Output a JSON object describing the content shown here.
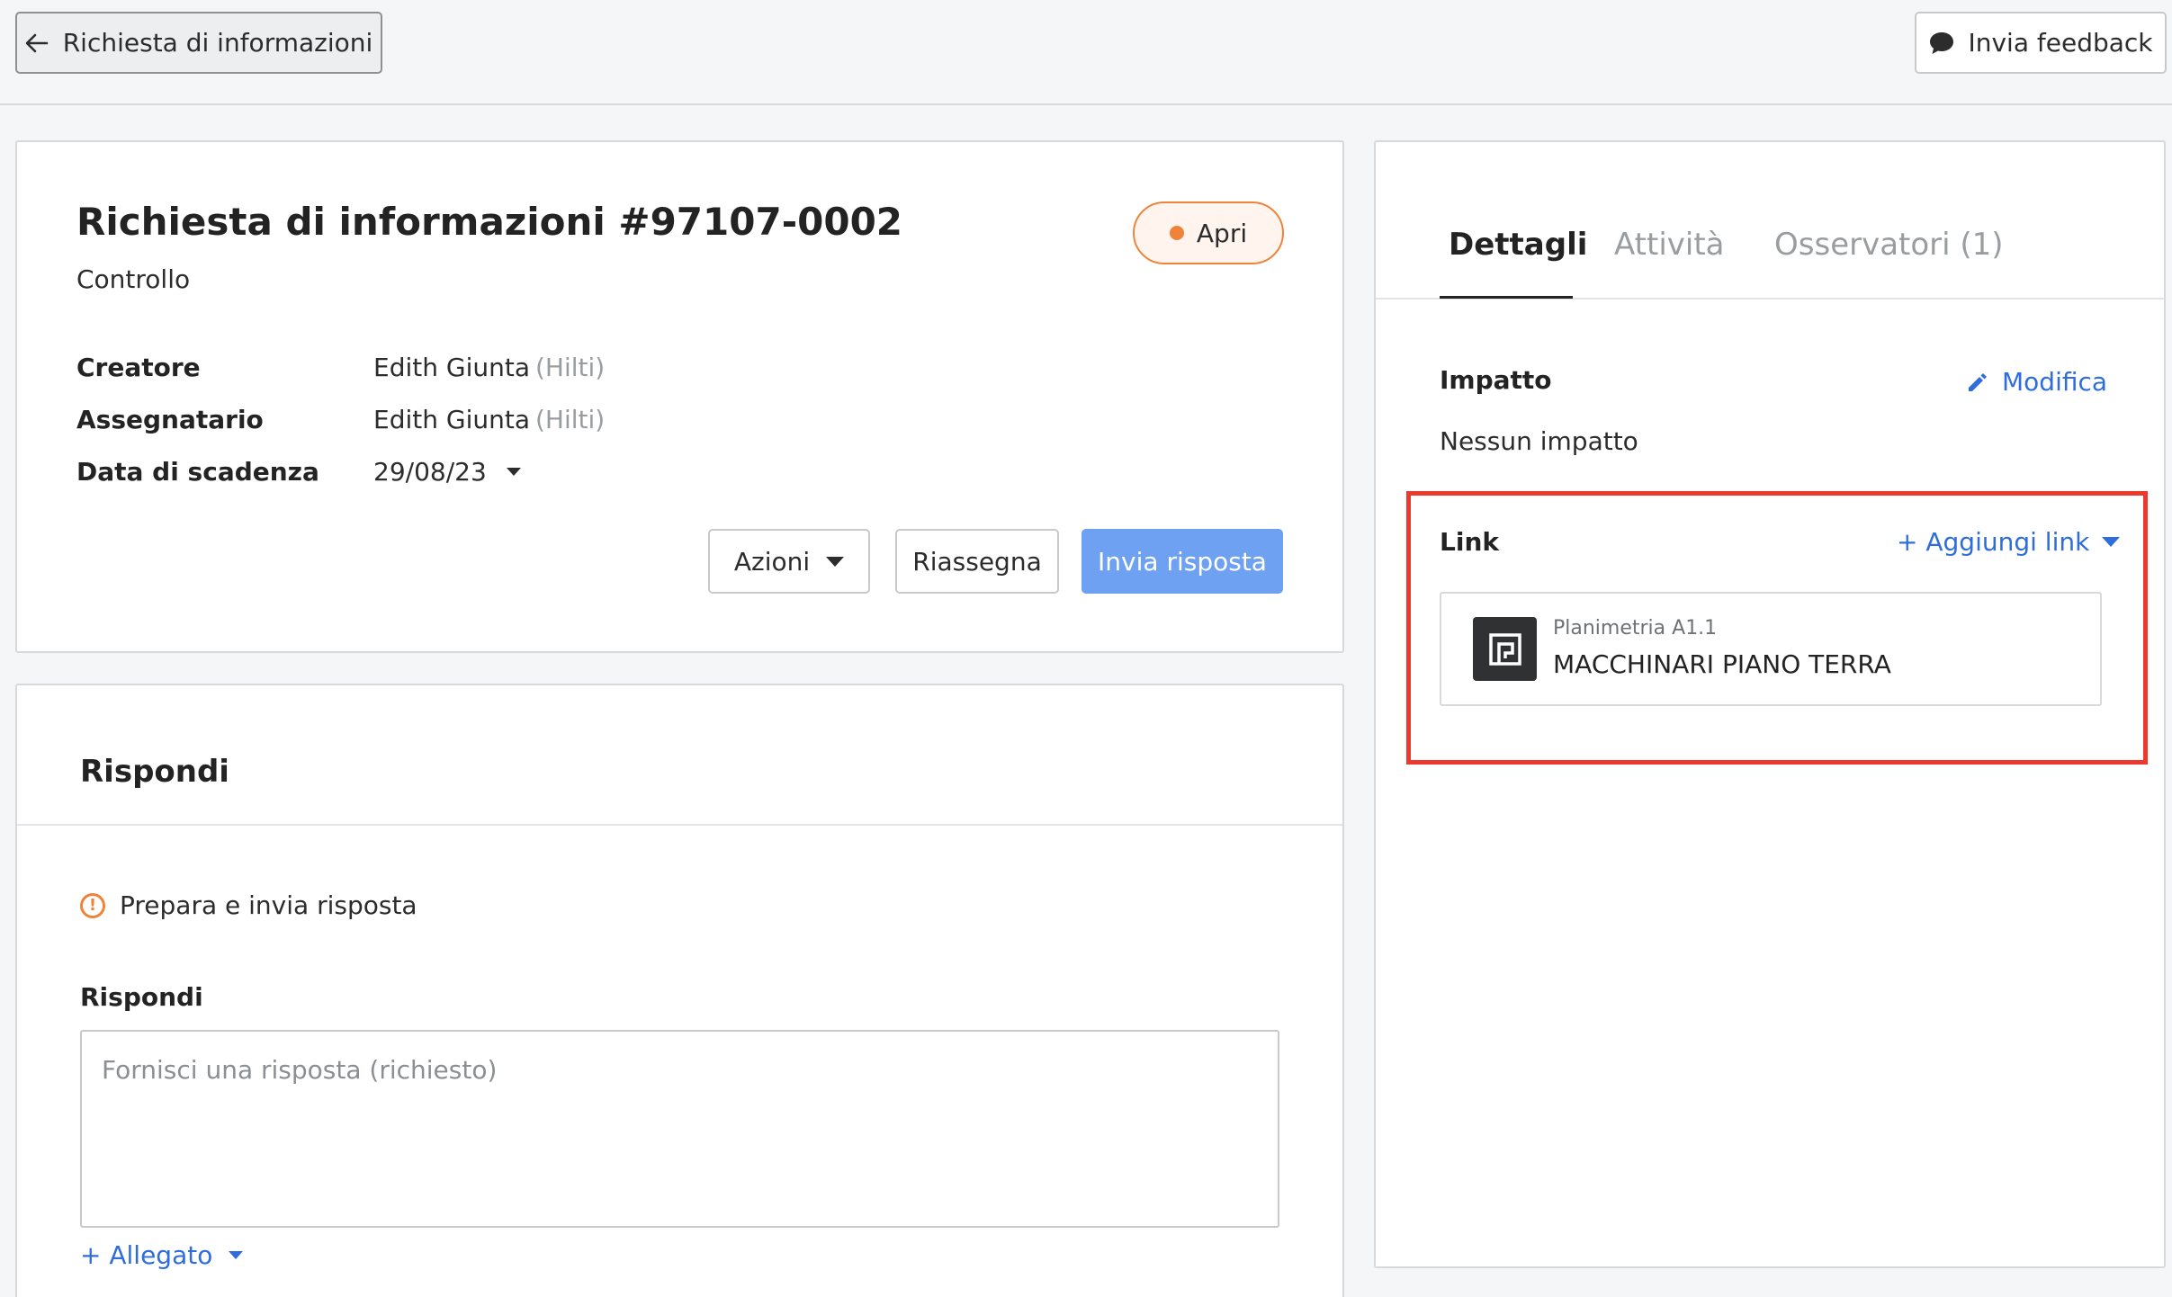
{
  "topbar": {
    "back_label": "Richiesta di informazioni",
    "feedback_label": "Invia feedback"
  },
  "main": {
    "title": "Richiesta di informazioni #97107-0002",
    "subtitle": "Controllo",
    "status": "Apri",
    "fields": [
      {
        "label": "Creatore",
        "name": "Edith Giunta",
        "org": "(Hilti)"
      },
      {
        "label": "Assegnatario",
        "name": "Edith Giunta",
        "org": "(Hilti)"
      },
      {
        "label": "Data di scadenza",
        "value": "29/08/23"
      }
    ],
    "actions_label": "Azioni",
    "reassign_label": "Riassegna",
    "send_label": "Invia risposta"
  },
  "reply": {
    "title": "Rispondi",
    "warning": "Prepara e invia risposta",
    "label": "Rispondi",
    "placeholder": "Fornisci una risposta (richiesto)",
    "attach_label": "+ Allegato"
  },
  "side": {
    "tabs": [
      "Dettagli",
      "Attività",
      "Osservatori (1)"
    ],
    "impact_label": "Impatto",
    "edit_label": "Modifica",
    "impact_value": "Nessun impatto",
    "link_label": "Link",
    "add_link_label": "+ Aggiungi link",
    "link_item": {
      "sub": "Planimetria A1.1",
      "main": "MACCHINARI PIANO TERRA"
    }
  },
  "colors": {
    "accent": "#2f6ddc",
    "status": "#f0833a",
    "primary_button": "#6fa1f2",
    "highlight": "#e93a2d"
  }
}
